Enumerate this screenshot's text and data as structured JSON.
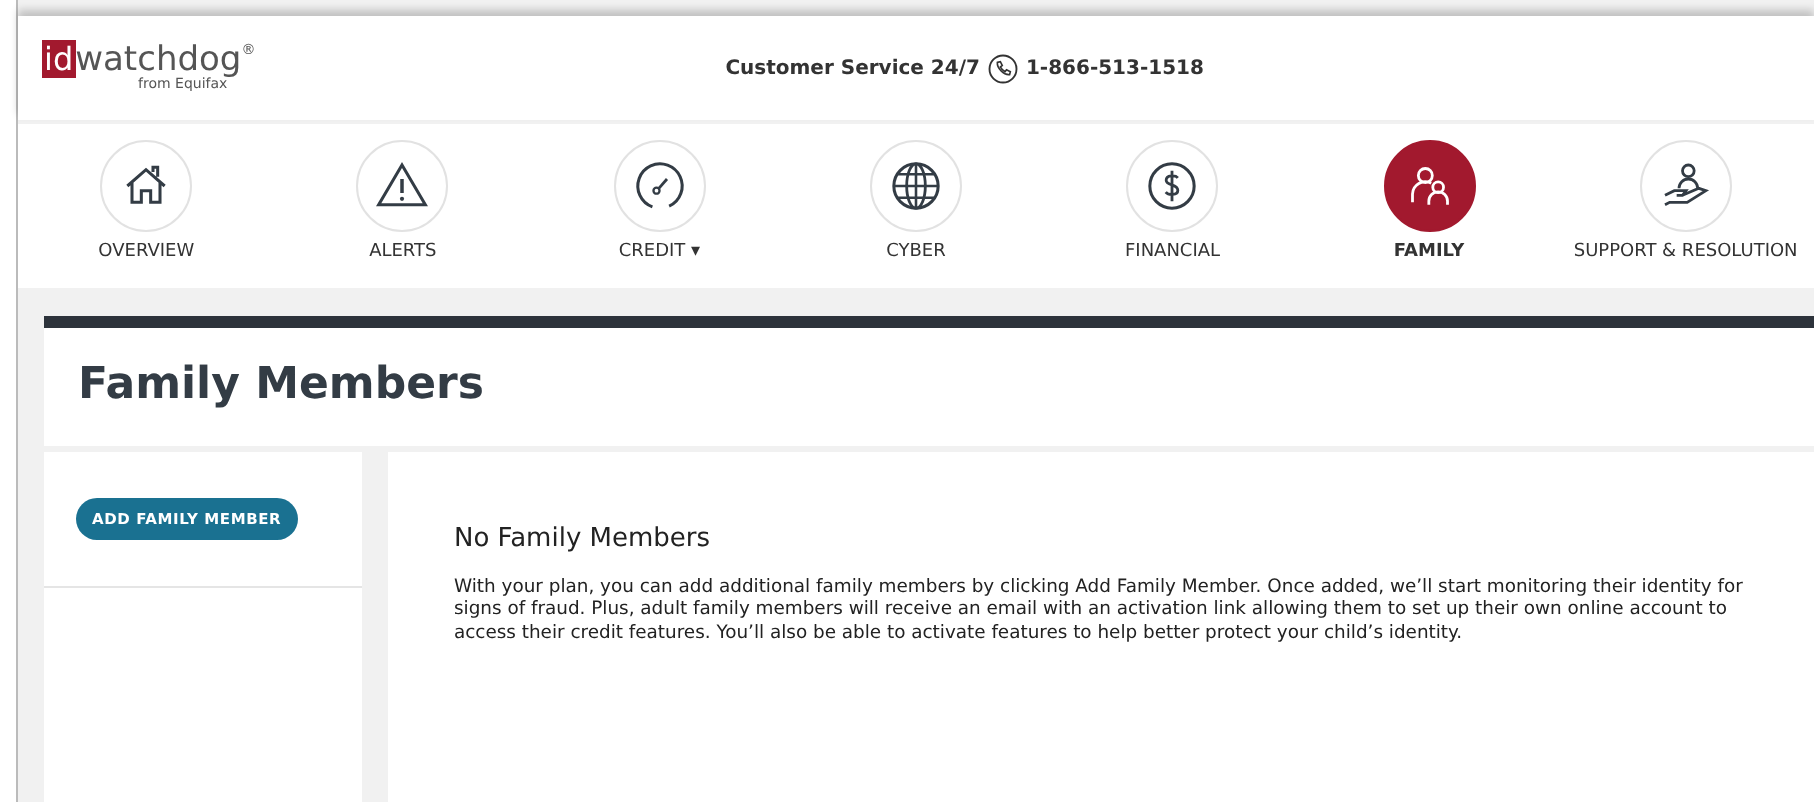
{
  "header": {
    "logo_mark": "id",
    "logo_word": "watchdog",
    "logo_reg": "®",
    "logo_sub": "from Equifax",
    "service_label": "Customer Service 24/7",
    "phone": "1-866-513-1518"
  },
  "nav": [
    {
      "label": "OVERVIEW",
      "selected": false
    },
    {
      "label": "ALERTS",
      "selected": false
    },
    {
      "label": "CREDIT",
      "caret": "▾",
      "selected": false
    },
    {
      "label": "CYBER",
      "selected": false
    },
    {
      "label": "FINANCIAL",
      "selected": false
    },
    {
      "label": "FAMILY",
      "selected": true
    },
    {
      "label": "SUPPORT & RESOLUTION",
      "selected": false
    }
  ],
  "page_title": "Family Members",
  "sidebar": {
    "button": "ADD FAMILY MEMBER"
  },
  "content": {
    "heading": "No Family Members",
    "body": "With your plan, you can add additional family members by clicking Add Family Member. Once added, we’ll start monitoring their identity for signs of fraud. Plus, adult family members will receive an email with an activation link allowing them to set up their own online account to access their credit features. You’ll also be able to activate features to help better protect your child’s identity."
  }
}
